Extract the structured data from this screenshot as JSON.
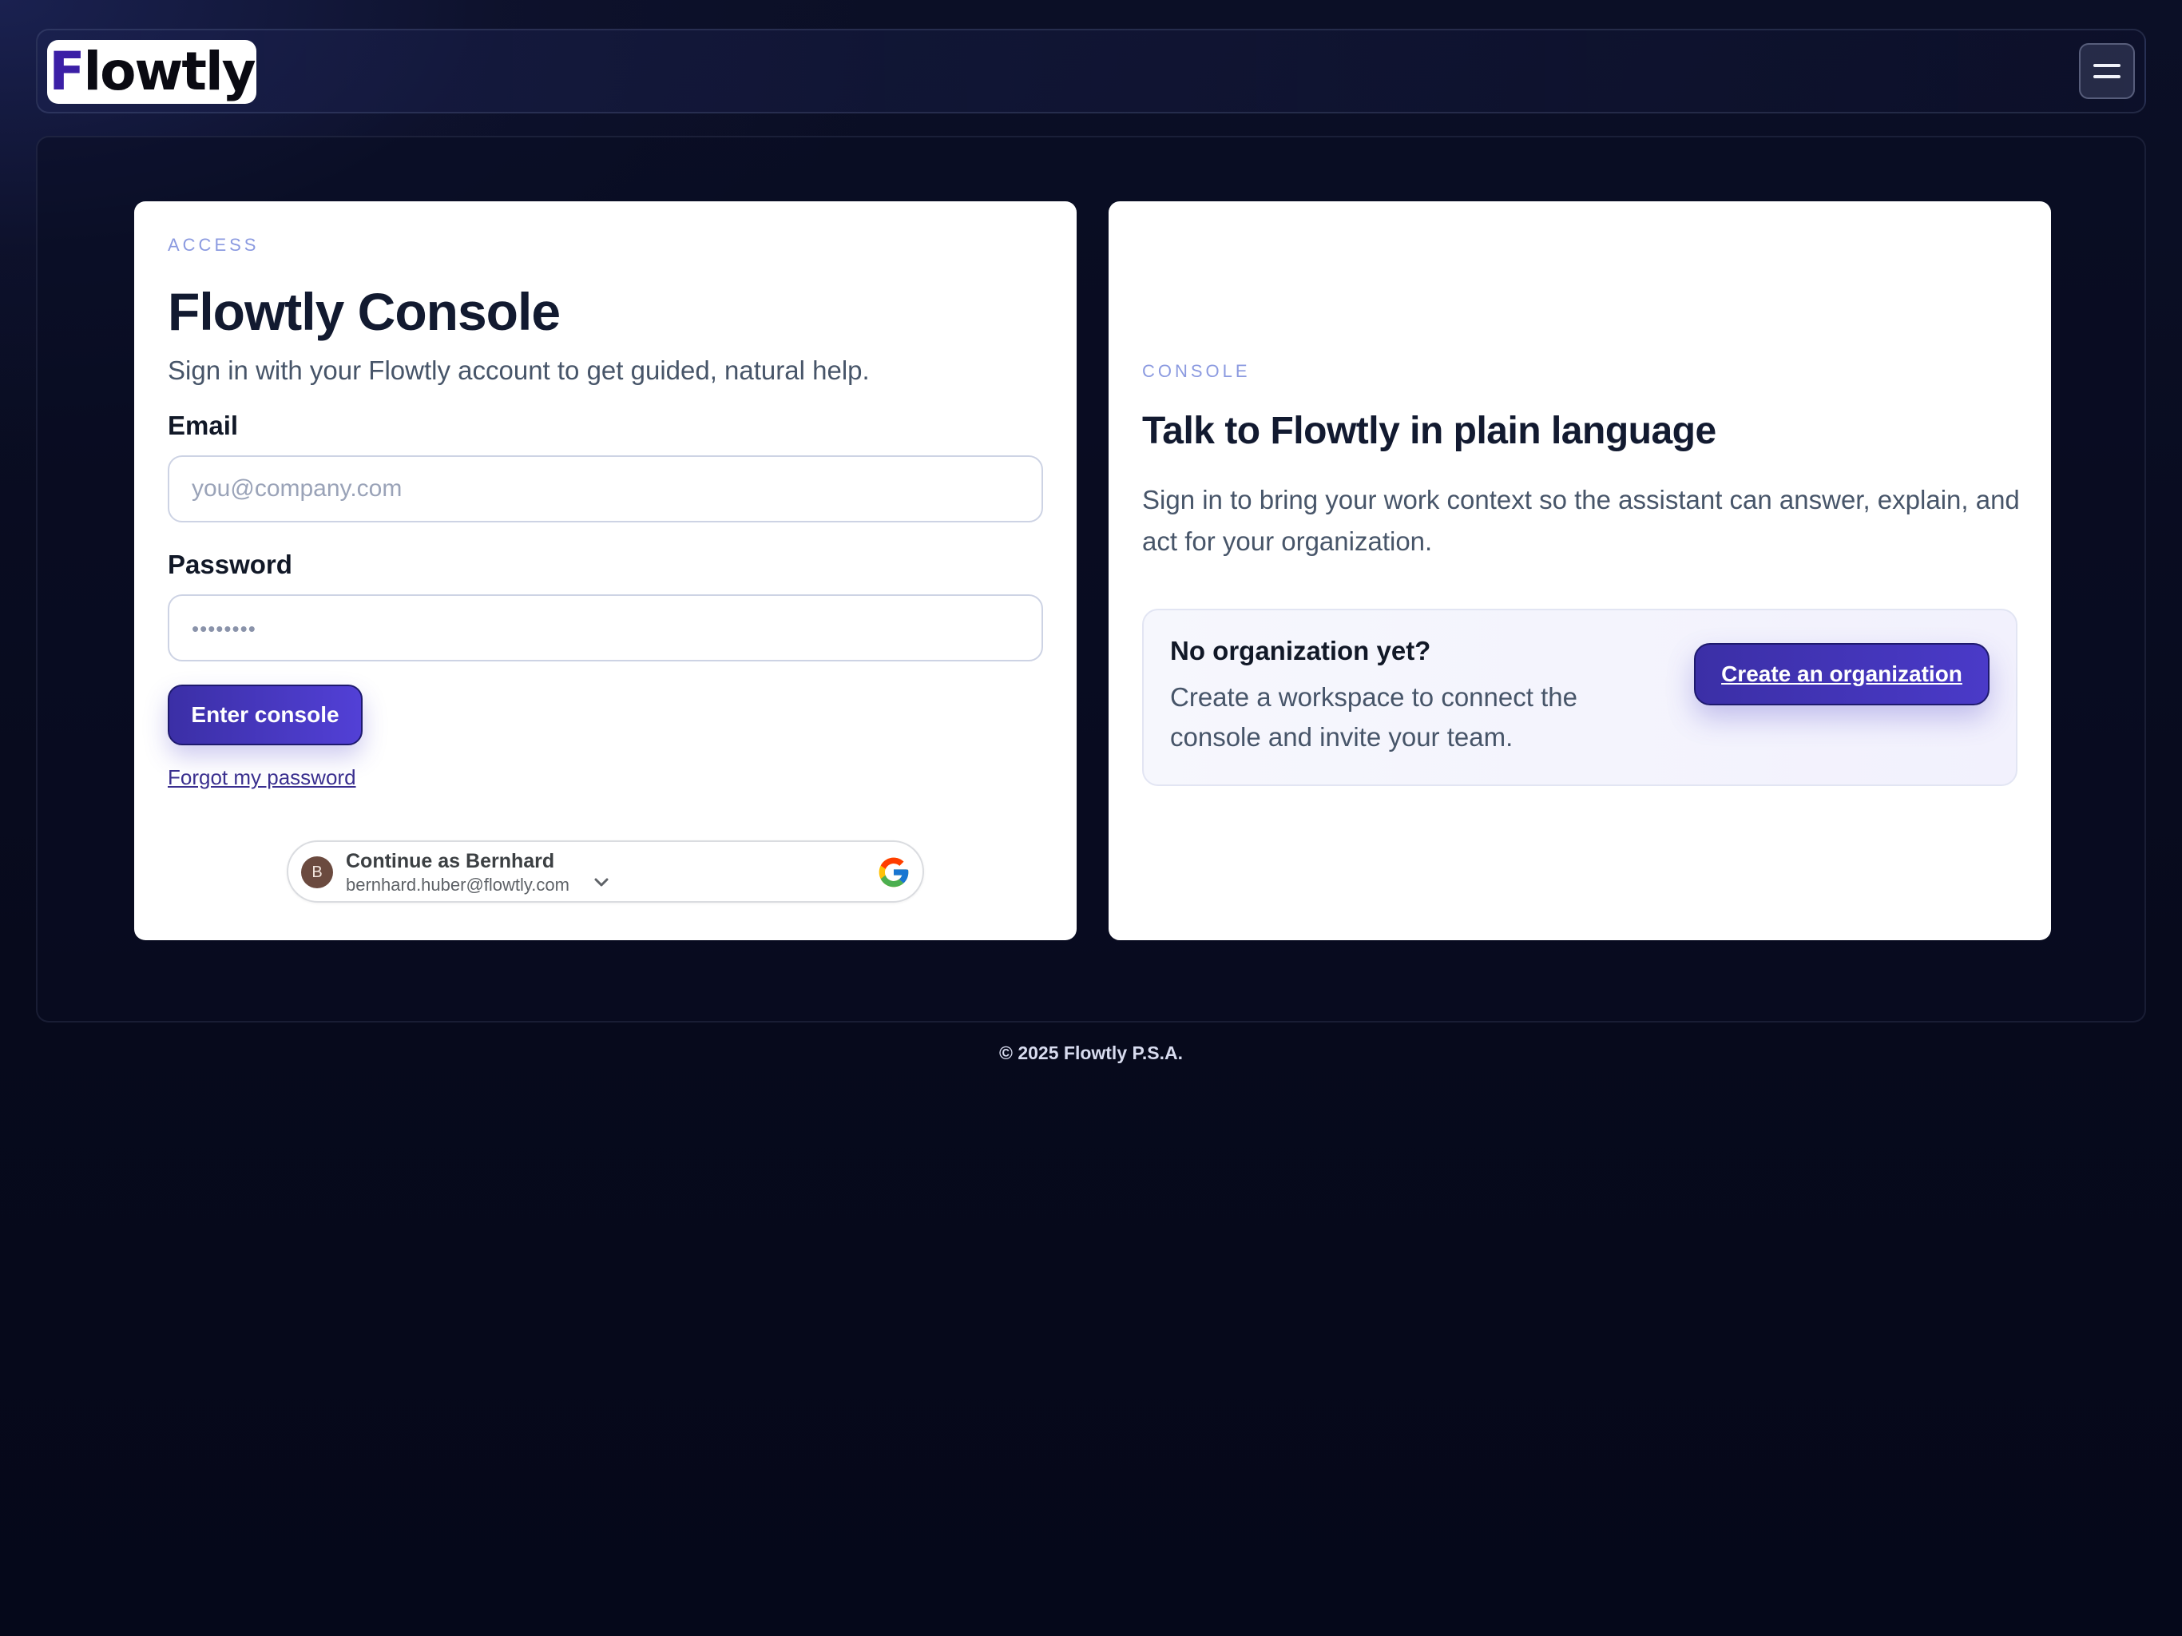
{
  "header": {
    "logo_text": "Flowtly",
    "menu_icon": "hamburger-menu-icon"
  },
  "login_card": {
    "eyebrow": "ACCESS",
    "title": "Flowtly Console",
    "subtitle": "Sign in with your Flowtly account to get guided, natural help.",
    "email_label": "Email",
    "email_placeholder": "you@company.com",
    "email_value": "",
    "password_label": "Password",
    "password_value": "••••••••",
    "submit_label": "Enter console",
    "forgot_label": "Forgot my password",
    "google": {
      "avatar_initial": "B",
      "name": "Continue as Bernhard",
      "email": "bernhard.huber@flowtly.com",
      "icon": "google-g-icon"
    }
  },
  "console_card": {
    "eyebrow": "CONSOLE",
    "title": "Talk to Flowtly in plain language",
    "description": "Sign in to bring your work context so the assistant can answer, explain, and act for your organization.",
    "org_box": {
      "title": "No organization yet?",
      "description": "Create a workspace to connect the console and invite your team.",
      "button_label": "Create an organization"
    }
  },
  "footer": {
    "copyright": "© 2025 Flowtly P.S.A."
  },
  "colors": {
    "accent": "#3b2fa6",
    "background": "#070a1c",
    "eyebrow": "#8b9ae0"
  }
}
